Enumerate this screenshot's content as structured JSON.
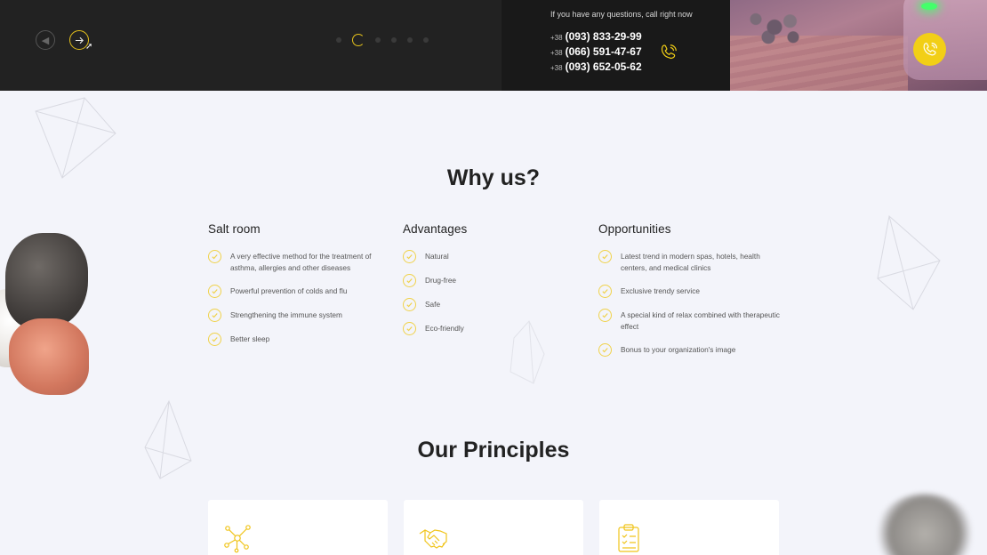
{
  "header": {
    "questions_text": "If you have any questions, call right now",
    "phones": [
      {
        "code": "+38",
        "number": "(093) 833-29-99"
      },
      {
        "code": "+38",
        "number": "(066) 591-47-67"
      },
      {
        "code": "+38",
        "number": "(093) 652-05-62"
      }
    ],
    "slider_dot_count": 6,
    "active_dot_index": 1
  },
  "why_us": {
    "title": "Why us?",
    "columns": [
      {
        "title": "Salt room",
        "items": [
          "A very effective method for the treatment of asthma, allergies and other diseases",
          "Powerful prevention of colds and flu",
          "Strengthening the immune system",
          "Better sleep"
        ]
      },
      {
        "title": "Advantages",
        "items": [
          "Natural",
          "Drug-free",
          "Safe",
          "Eco-friendly"
        ]
      },
      {
        "title": "Opportunities",
        "items": [
          "Latest trend in modern spas, hotels, health centers, and medical clinics",
          "Exclusive trendy service",
          "A special kind of relax combined with therapeutic effect",
          "Bonus to your organization's image"
        ]
      }
    ]
  },
  "principles": {
    "title": "Our Principles",
    "cards": [
      {
        "icon": "molecule-icon"
      },
      {
        "icon": "handshake-icon"
      },
      {
        "icon": "clipboard-icon"
      }
    ]
  },
  "colors": {
    "accent": "#f2cf16",
    "dark_bg": "#222222",
    "page_bg": "#f3f4fa"
  }
}
